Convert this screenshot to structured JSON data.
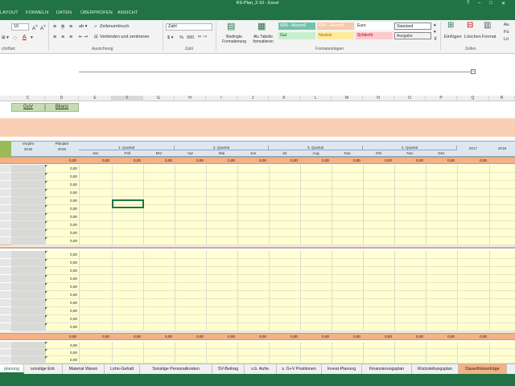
{
  "window": {
    "title": "RS-Plan_2-10 - Excel"
  },
  "ribbon_tabs": [
    "LAYOUT",
    "FORMELN",
    "DATEN",
    "ÜBERPRÜFEN",
    "ANSICHT"
  ],
  "ribbon": {
    "font_size": "10",
    "wrap_text": "Zeilenumbruch",
    "merge_center": "Verbinden und zentrieren",
    "number_format": "Zahl",
    "percent": "%",
    "thousands": "000",
    "cond_format": "Bedingte Formatierung",
    "as_table": "Als Tabelle formatieren",
    "insert": "Einfügen",
    "delete": "Löschen",
    "format": "Format",
    "groups": {
      "clipboard": "chriftart",
      "alignment": "Ausrichtung",
      "number": "Zahl",
      "styles": "Formatvorlagen",
      "cells": "Zellen"
    },
    "styles": [
      {
        "label": "60% - Akzent6",
        "bg": "#70c3a8",
        "fg": "#ffffff"
      },
      {
        "label": "60% - Akzent6",
        "bg": "#f7caa4",
        "fg": "#ffffff"
      },
      {
        "label": "Euro",
        "bg": "#ffffff",
        "fg": "#222222"
      },
      {
        "label": "Standard",
        "bg": "#ffffff",
        "fg": "#222222"
      },
      {
        "label": "Gut",
        "bg": "#c6efce",
        "fg": "#006100"
      },
      {
        "label": "Neutral",
        "bg": "#ffeb9c",
        "fg": "#9c6500"
      },
      {
        "label": "Schlecht",
        "bg": "#ffc7ce",
        "fg": "#9c0006"
      },
      {
        "label": "Ausgabe",
        "bg": "#f2f2f2",
        "fg": "#3f3f3f"
      }
    ],
    "right_stub": [
      "Au",
      "Fü",
      "Lö"
    ]
  },
  "columns": [
    "C",
    "D",
    "E",
    "F",
    "G",
    "H",
    "I",
    "J",
    "K",
    "L",
    "M",
    "N",
    "O",
    "P",
    "Q",
    "R"
  ],
  "nav_buttons": {
    "guv": "GuV",
    "bilanz": "Bilanz"
  },
  "header": {
    "vorjahr": "Vorjahr",
    "vorjahr_year": "2015",
    "planjahr": "Planjahr",
    "planjahr_year": "2016",
    "quarters": [
      "1. Quartal",
      "2. Quartal",
      "3. Quartal",
      "4. Quartal"
    ],
    "months": [
      "Jan",
      "Feb",
      "Mrz",
      "Apr",
      "Mai",
      "Jun",
      "Jul",
      "Aug",
      "Sep",
      "Okt",
      "Nov",
      "Dez"
    ],
    "years_after": [
      "2017",
      "2018"
    ]
  },
  "zero_value": "0,00",
  "sheet_tabs": [
    "planung",
    "sonstige Ertr.",
    "Material Waren",
    "Lohn-Gehalt",
    "Sonstige Personalkosten",
    "SV-Beitrag",
    "s.b. Aufw.",
    "s. G+V Positionen",
    "Invest-Planung",
    "Finanzierungsplan",
    "Rückstellungsplan",
    "Dauerfristverträge"
  ],
  "colors": {
    "excel_green": "#217346",
    "peach": "#f9cfb3",
    "total_row": "#f4b183",
    "input_yellow": "#ffffd0"
  }
}
